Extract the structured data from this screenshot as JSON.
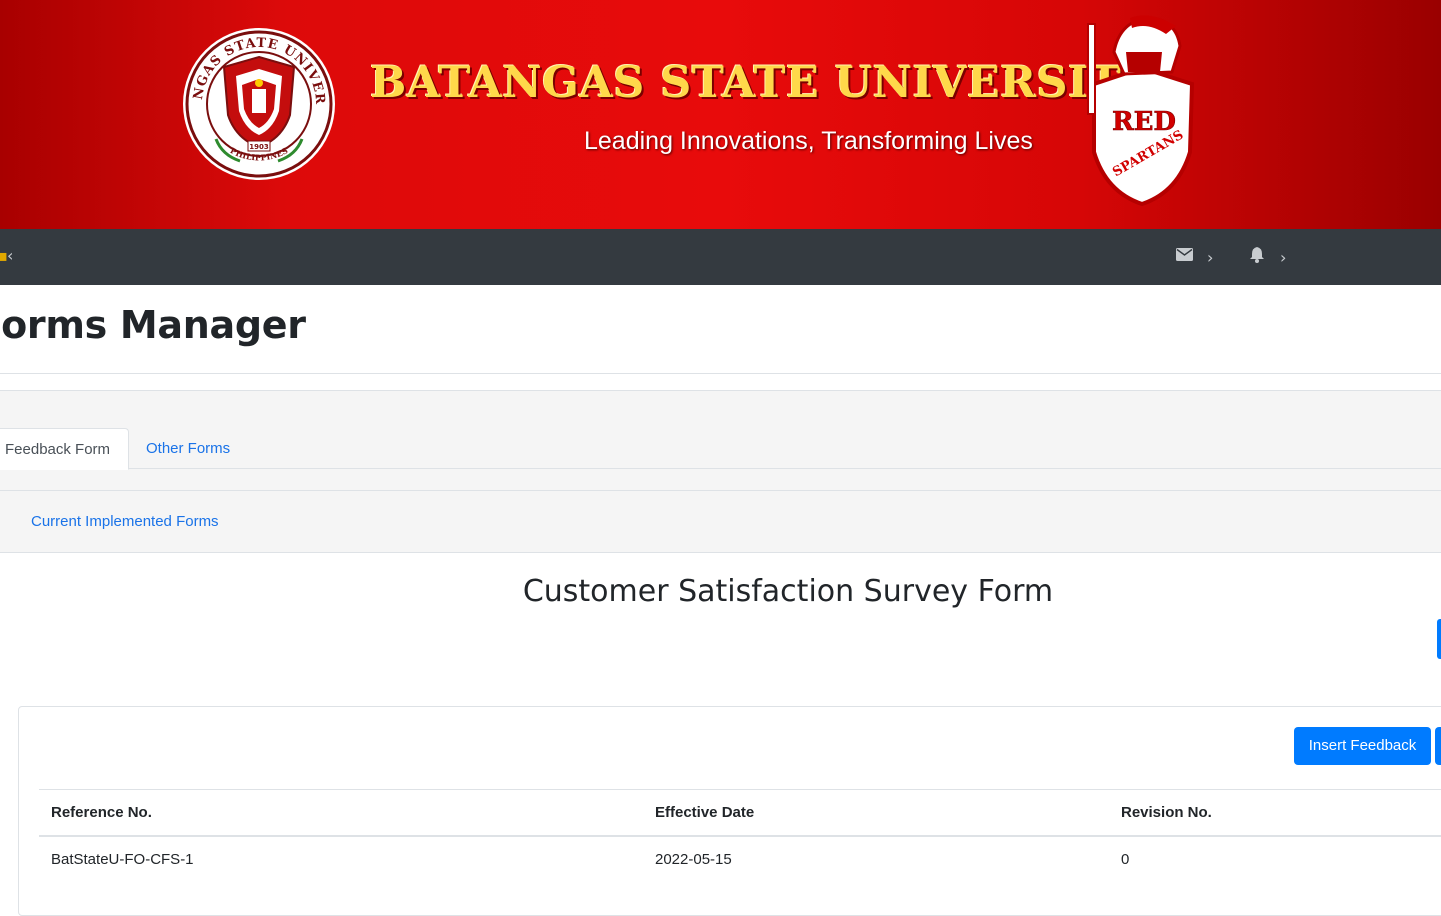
{
  "banner": {
    "title": "BATANGAS STATE UNIVERSITY",
    "tagline": "Leading Innovations, Transforming Lives",
    "seal_text_top": "BATANGAS STATE UNIVERSITY",
    "seal_text_bottom": "PHILIPPINES",
    "seal_year": "1903",
    "mascot_text_1": "RED",
    "mascot_text_2": "SPARTANS",
    "brand_red": "#e00b0b",
    "title_gold": "#ffd84a"
  },
  "navbar": {
    "left_toggle_icon": "chevron-left-icon",
    "mail_icon": "envelope-icon",
    "notification_icon": "bell-icon",
    "chevron": "›",
    "left_chevron": "‹",
    "background": "#343a40"
  },
  "page": {
    "title": "Forms Manager"
  },
  "tabs": [
    {
      "label": "Feedback Form",
      "active": true
    },
    {
      "label": "Other Forms",
      "active": false
    }
  ],
  "subnav": {
    "link": "Current Implemented Forms"
  },
  "survey": {
    "title": "Customer Satisfaction Survey Form"
  },
  "card": {
    "insert_button": "Insert Feedback",
    "table": {
      "headers": [
        "Reference No.",
        "Effective Date",
        "Revision No."
      ],
      "rows": [
        [
          "BatStateU-FO-CFS-1",
          "2022-05-15",
          "0"
        ]
      ]
    }
  },
  "colors": {
    "primary": "#007bff",
    "link": "#1a73e8"
  }
}
